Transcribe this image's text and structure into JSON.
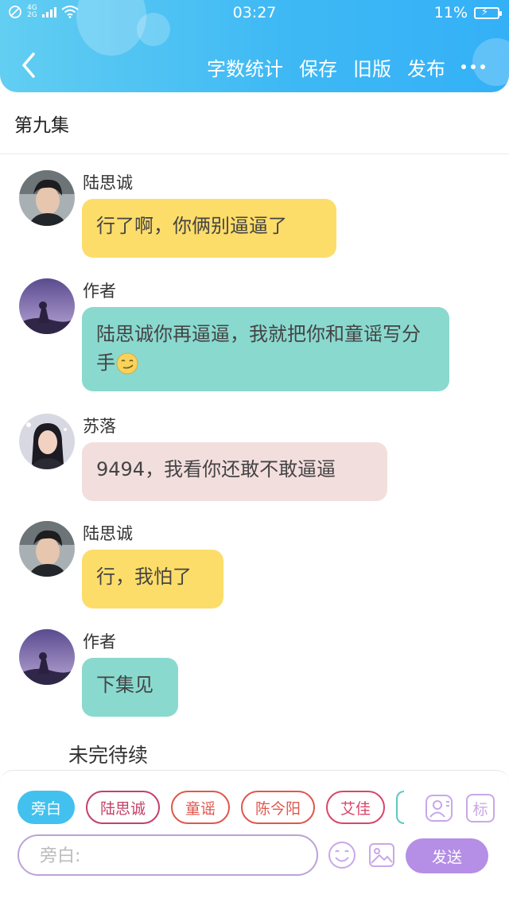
{
  "status_bar": {
    "network": [
      "4G",
      "2G"
    ],
    "time": "03:27",
    "battery": "11%"
  },
  "toolbar": {
    "actions": [
      "字数统计",
      "保存",
      "旧版",
      "发布"
    ]
  },
  "episode_title": "第九集",
  "messages": [
    {
      "speaker": "陆思诚",
      "text": "行了啊，你俩别逼逼了",
      "color": "#fddd6a"
    },
    {
      "speaker": "作者",
      "text": "陆思诚你再逼逼，我就把你和童谣写分手",
      "emoji": "smirk-emoji",
      "color": "#8ad9cf"
    },
    {
      "speaker": "苏落",
      "text": "9494，我看你还敢不敢逼逼",
      "color": "#f3dede"
    },
    {
      "speaker": "陆思诚",
      "text": "行，我怕了",
      "color": "#fddd6a"
    },
    {
      "speaker": "作者",
      "text": "下集见",
      "color": "#8ad9cf"
    }
  ],
  "continuation": "未完待续",
  "composer": {
    "roles": [
      "旁白",
      "陆思诚",
      "童谣",
      "陈今阳",
      "艾佳"
    ],
    "active_role": "旁白",
    "input_placeholder": "旁白:",
    "send_label": "发送",
    "tag_label": "标"
  },
  "colors": {
    "header": "#3fb9f4",
    "send_button": "#b58ee6",
    "active_chip": "#42c1ee"
  }
}
